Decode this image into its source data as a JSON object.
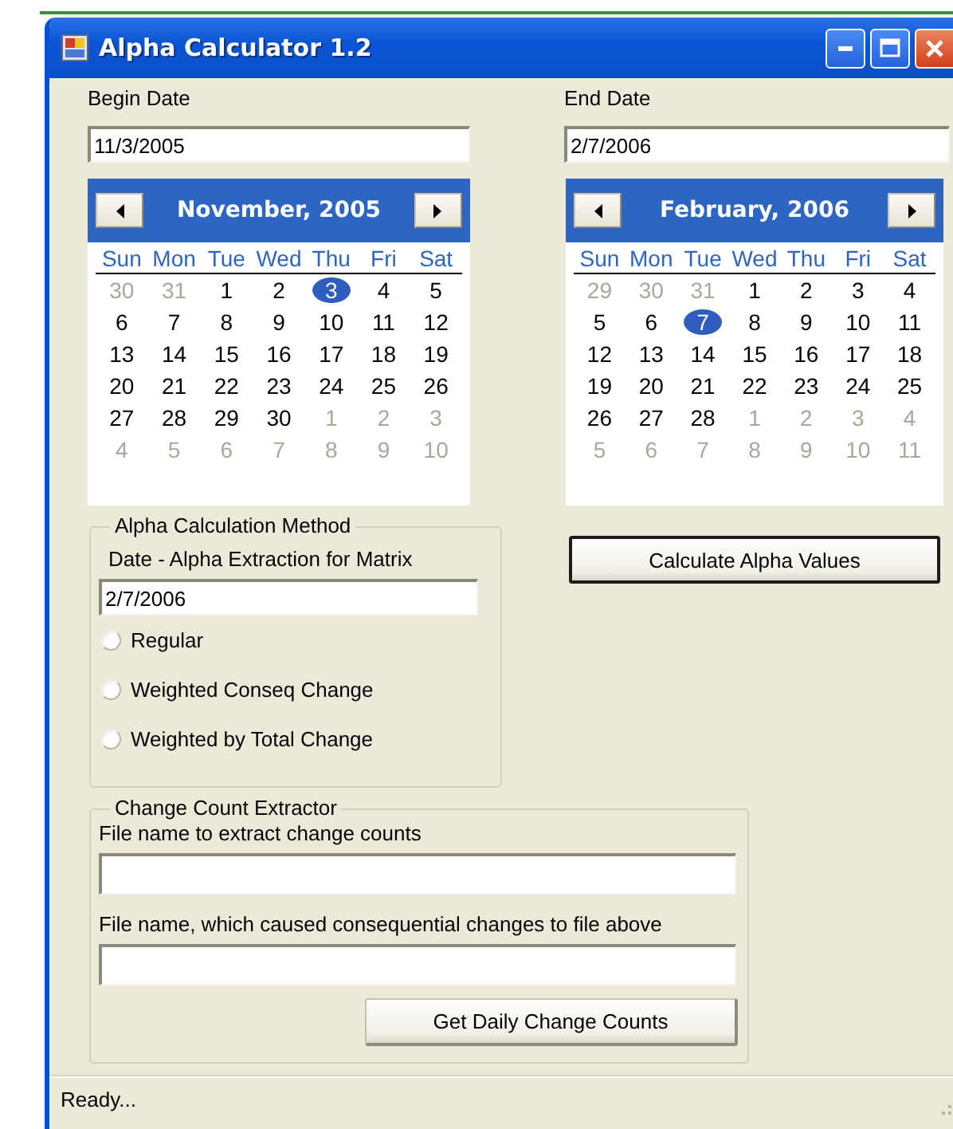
{
  "window": {
    "title": "Alpha Calculator 1.2"
  },
  "begin_date": {
    "label": "Begin Date",
    "value": "11/3/2005"
  },
  "end_date": {
    "label": "End Date",
    "value": "2/7/2006"
  },
  "calendars": [
    {
      "month_label": "November, 2005",
      "weekdays": [
        "Sun",
        "Mon",
        "Tue",
        "Wed",
        "Thu",
        "Fri",
        "Sat"
      ],
      "weeks": [
        [
          {
            "day": "30",
            "in_month": false,
            "selected": false
          },
          {
            "day": "31",
            "in_month": false,
            "selected": false
          },
          {
            "day": "1",
            "in_month": true,
            "selected": false
          },
          {
            "day": "2",
            "in_month": true,
            "selected": false
          },
          {
            "day": "3",
            "in_month": true,
            "selected": true
          },
          {
            "day": "4",
            "in_month": true,
            "selected": false
          },
          {
            "day": "5",
            "in_month": true,
            "selected": false
          }
        ],
        [
          {
            "day": "6",
            "in_month": true,
            "selected": false
          },
          {
            "day": "7",
            "in_month": true,
            "selected": false
          },
          {
            "day": "8",
            "in_month": true,
            "selected": false
          },
          {
            "day": "9",
            "in_month": true,
            "selected": false
          },
          {
            "day": "10",
            "in_month": true,
            "selected": false
          },
          {
            "day": "11",
            "in_month": true,
            "selected": false
          },
          {
            "day": "12",
            "in_month": true,
            "selected": false
          }
        ],
        [
          {
            "day": "13",
            "in_month": true,
            "selected": false
          },
          {
            "day": "14",
            "in_month": true,
            "selected": false
          },
          {
            "day": "15",
            "in_month": true,
            "selected": false
          },
          {
            "day": "16",
            "in_month": true,
            "selected": false
          },
          {
            "day": "17",
            "in_month": true,
            "selected": false
          },
          {
            "day": "18",
            "in_month": true,
            "selected": false
          },
          {
            "day": "19",
            "in_month": true,
            "selected": false
          }
        ],
        [
          {
            "day": "20",
            "in_month": true,
            "selected": false
          },
          {
            "day": "21",
            "in_month": true,
            "selected": false
          },
          {
            "day": "22",
            "in_month": true,
            "selected": false
          },
          {
            "day": "23",
            "in_month": true,
            "selected": false
          },
          {
            "day": "24",
            "in_month": true,
            "selected": false
          },
          {
            "day": "25",
            "in_month": true,
            "selected": false
          },
          {
            "day": "26",
            "in_month": true,
            "selected": false
          }
        ],
        [
          {
            "day": "27",
            "in_month": true,
            "selected": false
          },
          {
            "day": "28",
            "in_month": true,
            "selected": false
          },
          {
            "day": "29",
            "in_month": true,
            "selected": false
          },
          {
            "day": "30",
            "in_month": true,
            "selected": false
          },
          {
            "day": "1",
            "in_month": false,
            "selected": false
          },
          {
            "day": "2",
            "in_month": false,
            "selected": false
          },
          {
            "day": "3",
            "in_month": false,
            "selected": false
          }
        ],
        [
          {
            "day": "4",
            "in_month": false,
            "selected": false
          },
          {
            "day": "5",
            "in_month": false,
            "selected": false
          },
          {
            "day": "6",
            "in_month": false,
            "selected": false
          },
          {
            "day": "7",
            "in_month": false,
            "selected": false
          },
          {
            "day": "8",
            "in_month": false,
            "selected": false
          },
          {
            "day": "9",
            "in_month": false,
            "selected": false
          },
          {
            "day": "10",
            "in_month": false,
            "selected": false
          }
        ]
      ]
    },
    {
      "month_label": "February, 2006",
      "weekdays": [
        "Sun",
        "Mon",
        "Tue",
        "Wed",
        "Thu",
        "Fri",
        "Sat"
      ],
      "weeks": [
        [
          {
            "day": "29",
            "in_month": false,
            "selected": false
          },
          {
            "day": "30",
            "in_month": false,
            "selected": false
          },
          {
            "day": "31",
            "in_month": false,
            "selected": false
          },
          {
            "day": "1",
            "in_month": true,
            "selected": false
          },
          {
            "day": "2",
            "in_month": true,
            "selected": false
          },
          {
            "day": "3",
            "in_month": true,
            "selected": false
          },
          {
            "day": "4",
            "in_month": true,
            "selected": false
          }
        ],
        [
          {
            "day": "5",
            "in_month": true,
            "selected": false
          },
          {
            "day": "6",
            "in_month": true,
            "selected": false
          },
          {
            "day": "7",
            "in_month": true,
            "selected": true
          },
          {
            "day": "8",
            "in_month": true,
            "selected": false
          },
          {
            "day": "9",
            "in_month": true,
            "selected": false
          },
          {
            "day": "10",
            "in_month": true,
            "selected": false
          },
          {
            "day": "11",
            "in_month": true,
            "selected": false
          }
        ],
        [
          {
            "day": "12",
            "in_month": true,
            "selected": false
          },
          {
            "day": "13",
            "in_month": true,
            "selected": false
          },
          {
            "day": "14",
            "in_month": true,
            "selected": false
          },
          {
            "day": "15",
            "in_month": true,
            "selected": false
          },
          {
            "day": "16",
            "in_month": true,
            "selected": false
          },
          {
            "day": "17",
            "in_month": true,
            "selected": false
          },
          {
            "day": "18",
            "in_month": true,
            "selected": false
          }
        ],
        [
          {
            "day": "19",
            "in_month": true,
            "selected": false
          },
          {
            "day": "20",
            "in_month": true,
            "selected": false
          },
          {
            "day": "21",
            "in_month": true,
            "selected": false
          },
          {
            "day": "22",
            "in_month": true,
            "selected": false
          },
          {
            "day": "23",
            "in_month": true,
            "selected": false
          },
          {
            "day": "24",
            "in_month": true,
            "selected": false
          },
          {
            "day": "25",
            "in_month": true,
            "selected": false
          }
        ],
        [
          {
            "day": "26",
            "in_month": true,
            "selected": false
          },
          {
            "day": "27",
            "in_month": true,
            "selected": false
          },
          {
            "day": "28",
            "in_month": true,
            "selected": false
          },
          {
            "day": "1",
            "in_month": false,
            "selected": false
          },
          {
            "day": "2",
            "in_month": false,
            "selected": false
          },
          {
            "day": "3",
            "in_month": false,
            "selected": false
          },
          {
            "day": "4",
            "in_month": false,
            "selected": false
          }
        ],
        [
          {
            "day": "5",
            "in_month": false,
            "selected": false
          },
          {
            "day": "6",
            "in_month": false,
            "selected": false
          },
          {
            "day": "7",
            "in_month": false,
            "selected": false
          },
          {
            "day": "8",
            "in_month": false,
            "selected": false
          },
          {
            "day": "9",
            "in_month": false,
            "selected": false
          },
          {
            "day": "10",
            "in_month": false,
            "selected": false
          },
          {
            "day": "11",
            "in_month": false,
            "selected": false
          }
        ]
      ]
    }
  ],
  "alpha_method": {
    "title": "Alpha Calculation Method",
    "date_label": "Date - Alpha Extraction for Matrix",
    "date_value": "2/7/2006",
    "options": [
      {
        "label": "Regular",
        "selected": false
      },
      {
        "label": "Weighted Conseq Change",
        "selected": false
      },
      {
        "label": "Weighted by Total Change",
        "selected": false
      }
    ]
  },
  "calculate_button": "Calculate Alpha Values",
  "change_count_extractor": {
    "title": "Change Count Extractor",
    "fields": [
      {
        "label": "File name to extract change counts"
      },
      {
        "label": "File name, which caused consequential changes to file above"
      }
    ],
    "button": "Get Daily Change Counts"
  },
  "status_bar": {
    "text": "Ready..."
  }
}
